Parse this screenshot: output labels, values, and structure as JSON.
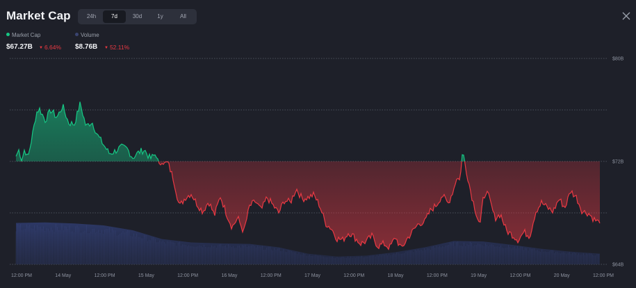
{
  "header": {
    "title": "Market Cap",
    "tabs": [
      {
        "label": "24h",
        "active": false
      },
      {
        "label": "7d",
        "active": true
      },
      {
        "label": "30d",
        "active": false
      },
      {
        "label": "1y",
        "active": false
      },
      {
        "label": "All",
        "active": false
      }
    ],
    "close_icon": "close-icon"
  },
  "legend": {
    "market_cap": {
      "label": "Market Cap",
      "value": "$67.27B",
      "change": "6.64%",
      "color": "#16c784"
    },
    "volume": {
      "label": "Volume",
      "value": "$8.76B",
      "change": "52.11%",
      "color": "#3a4470"
    }
  },
  "colors": {
    "up": "#16c784",
    "down": "#ea3943",
    "volume": "#2b3766",
    "background": "#1e2029"
  },
  "chart_data": {
    "type": "area",
    "title": "Market Cap",
    "ylim": [
      64,
      80
    ],
    "baseline": 72,
    "y_ticks": [
      "$64B",
      "$72B",
      "$80B"
    ],
    "x_tick_labels": [
      "12:00 PM",
      "14 May",
      "12:00 PM",
      "15 May",
      "12:00 PM",
      "16 May",
      "12:00 PM",
      "17 May",
      "12:00 PM",
      "18 May",
      "12:00 PM",
      "19 May",
      "12:00 PM",
      "20 May",
      "12:00 PM"
    ],
    "grid": true,
    "series": [
      {
        "name": "Market Cap",
        "unit": "B USD",
        "x": [
          0,
          0.005,
          0.01,
          0.015,
          0.02,
          0.025,
          0.03,
          0.035,
          0.04,
          0.05,
          0.06,
          0.07,
          0.08,
          0.09,
          0.1,
          0.11,
          0.115,
          0.12,
          0.13,
          0.14,
          0.15,
          0.16,
          0.17,
          0.18,
          0.19,
          0.2,
          0.21,
          0.22,
          0.23,
          0.24,
          0.245,
          0.25,
          0.255,
          0.26,
          0.27,
          0.28,
          0.29,
          0.3,
          0.31,
          0.32,
          0.33,
          0.34,
          0.35,
          0.36,
          0.37,
          0.38,
          0.39,
          0.4,
          0.41,
          0.42,
          0.43,
          0.44,
          0.45,
          0.46,
          0.47,
          0.48,
          0.49,
          0.5,
          0.51,
          0.52,
          0.53,
          0.54,
          0.55,
          0.56,
          0.57,
          0.58,
          0.59,
          0.6,
          0.61,
          0.62,
          0.63,
          0.64,
          0.65,
          0.66,
          0.67,
          0.68,
          0.69,
          0.7,
          0.71,
          0.72,
          0.73,
          0.74,
          0.75,
          0.755,
          0.76,
          0.765,
          0.77,
          0.78,
          0.79,
          0.795,
          0.8,
          0.805,
          0.81,
          0.82,
          0.83,
          0.84,
          0.85,
          0.86,
          0.87,
          0.88,
          0.89,
          0.9,
          0.91,
          0.92,
          0.93,
          0.94,
          0.95,
          0.96,
          0.97,
          0.98,
          0.99,
          1
        ],
        "values": [
          72.4,
          72.9,
          72.1,
          73.0,
          72.2,
          73.3,
          74.5,
          75.8,
          76.1,
          75.2,
          76.0,
          75.4,
          76.3,
          75.0,
          74.9,
          76.5,
          75.6,
          74.7,
          75.1,
          74.0,
          73.3,
          72.6,
          72.8,
          73.1,
          73.0,
          72.3,
          72.7,
          72.9,
          72.2,
          72.6,
          71.6,
          72.1,
          71.8,
          71.9,
          70.6,
          68.5,
          69.2,
          69.5,
          68.7,
          68.1,
          68.9,
          67.8,
          69.3,
          68.0,
          66.9,
          67.6,
          66.5,
          68.5,
          68.9,
          68.2,
          69.2,
          68.6,
          68.0,
          69.0,
          68.8,
          69.9,
          69.1,
          69.2,
          69.4,
          68.6,
          67.2,
          66.8,
          66.0,
          65.9,
          66.5,
          66.1,
          65.6,
          65.8,
          66.2,
          65.4,
          65.6,
          65.3,
          66.1,
          65.2,
          66.0,
          66.6,
          67.2,
          67.3,
          68.2,
          68.6,
          69.4,
          68.7,
          69.9,
          70.8,
          70.5,
          72.8,
          71.6,
          69.4,
          67.7,
          67.1,
          69.0,
          69.7,
          69.2,
          67.6,
          67.9,
          66.6,
          66.3,
          65.9,
          66.5,
          66.2,
          68.1,
          68.8,
          68.4,
          68.1,
          69.1,
          68.4,
          69.7,
          69.2,
          68.1,
          68.0,
          67.5,
          67.2
        ],
        "color_above": "#16c784",
        "color_below": "#ea3943"
      },
      {
        "name": "Volume",
        "unit": "relative",
        "x": [
          0,
          0.05,
          0.1,
          0.15,
          0.2,
          0.25,
          0.3,
          0.35,
          0.4,
          0.45,
          0.5,
          0.55,
          0.6,
          0.65,
          0.7,
          0.75,
          0.8,
          0.85,
          0.9,
          0.95,
          1
        ],
        "values": [
          0.85,
          0.86,
          0.84,
          0.8,
          0.7,
          0.52,
          0.45,
          0.43,
          0.42,
          0.35,
          0.22,
          0.16,
          0.18,
          0.25,
          0.35,
          0.48,
          0.47,
          0.4,
          0.32,
          0.26,
          0.22
        ]
      }
    ]
  }
}
